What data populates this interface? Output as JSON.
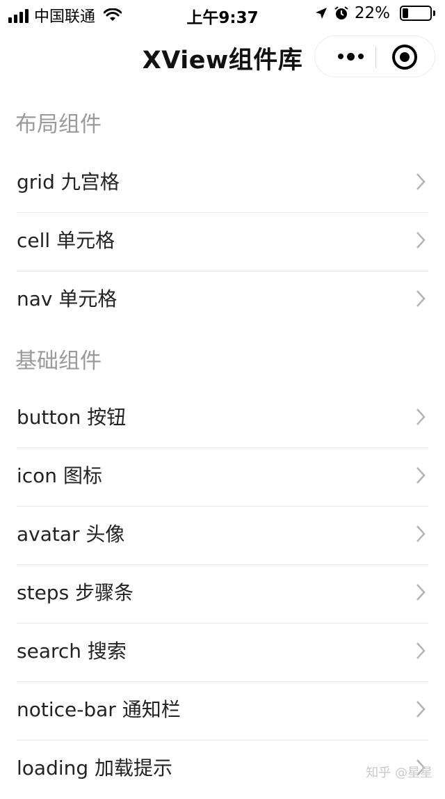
{
  "status_bar": {
    "carrier": "中国联通",
    "time": "上午9:37",
    "battery_percent": "22%",
    "battery_level": 0.22
  },
  "nav": {
    "title": "XView组件库",
    "more_icon": "ellipsis-icon",
    "close_icon": "target-icon"
  },
  "sections": [
    {
      "title": "布局组件",
      "items": [
        "grid 九宫格",
        "cell 单元格",
        "nav 单元格"
      ]
    },
    {
      "title": "基础组件",
      "items": [
        "button 按钮",
        "icon 图标",
        "avatar 头像",
        "steps 步骤条",
        "search 搜索",
        "notice-bar 通知栏",
        "loading 加载提示"
      ]
    }
  ],
  "watermark": "知乎 @星星"
}
